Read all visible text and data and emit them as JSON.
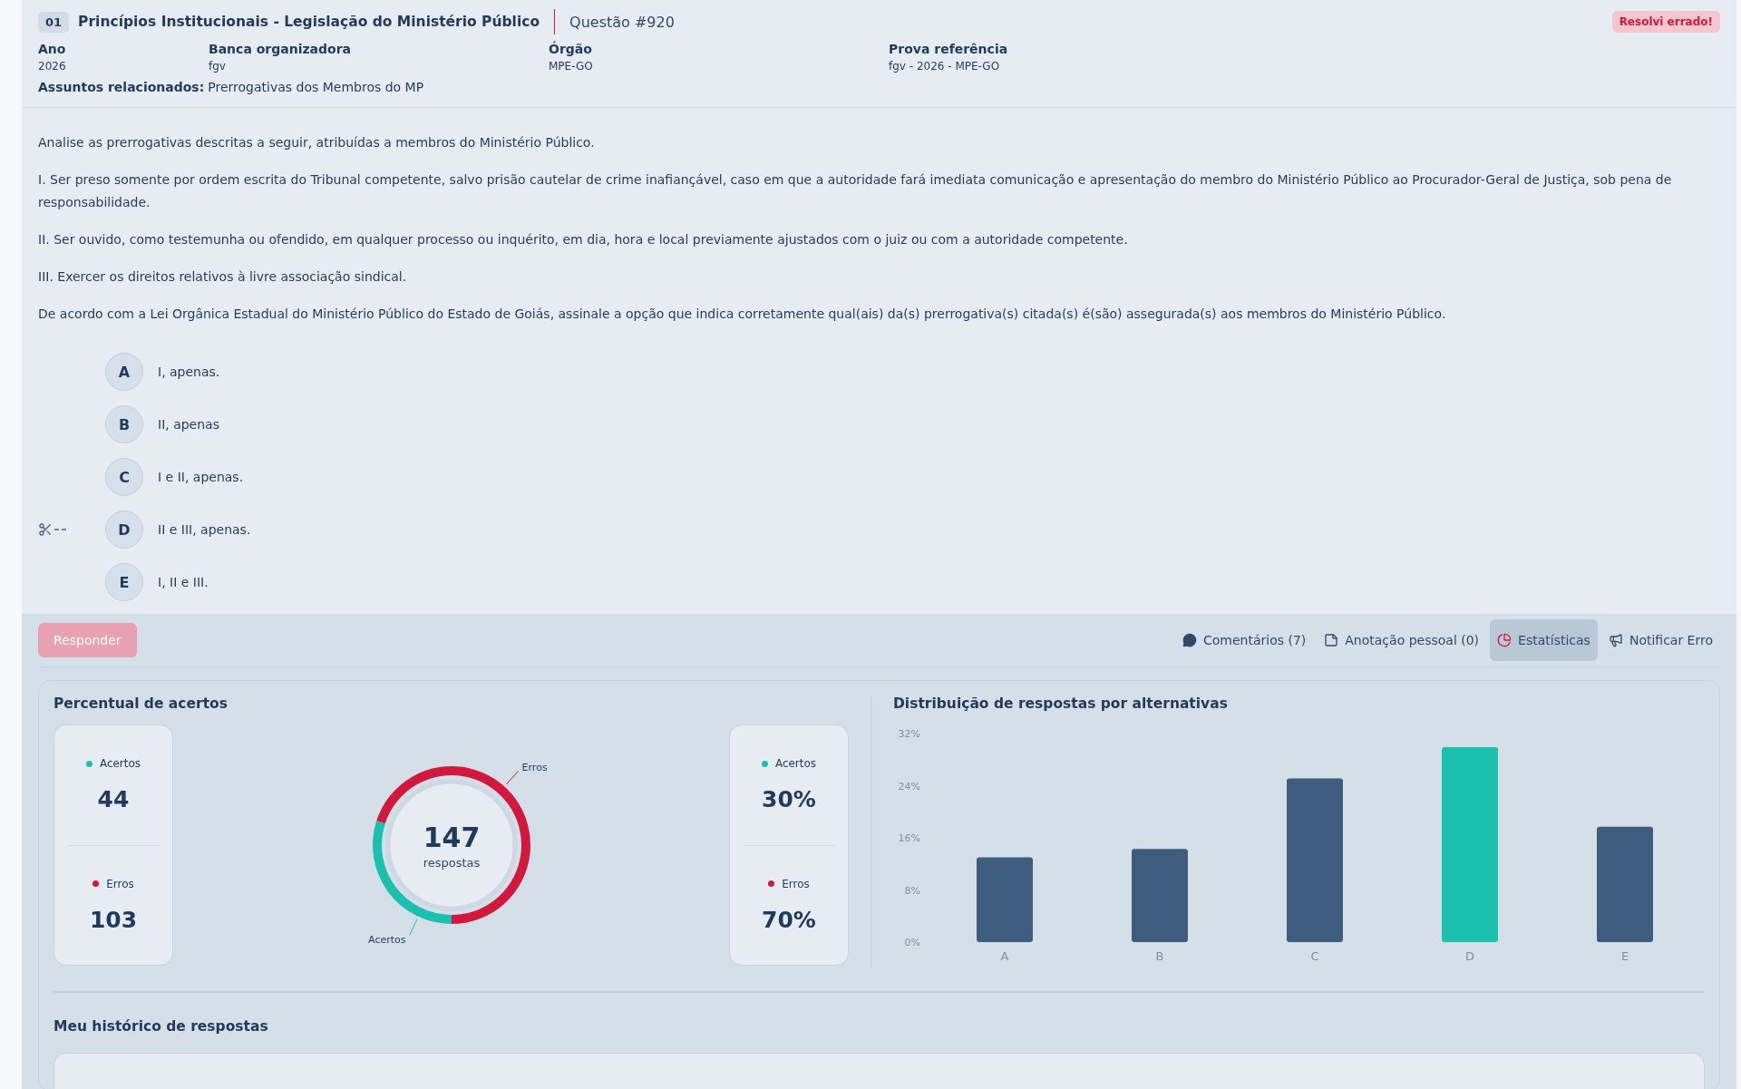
{
  "header": {
    "number": "01",
    "title": "Princípios Institucionais - Legislação do Ministério Público",
    "question": "Questão #920",
    "status_badge": "Resolvi errado!"
  },
  "meta": [
    {
      "label": "Ano",
      "value": "2026"
    },
    {
      "label": "Banca organizadora",
      "value": "fgv"
    },
    {
      "label": "Órgão",
      "value": "MPE-GO"
    },
    {
      "label": "Prova referência",
      "value": "fgv - 2026 - MPE-GO"
    }
  ],
  "subjects": {
    "label": "Assuntos relacionados:",
    "value": "Prerrogativas dos Membros do MP"
  },
  "statement": [
    "Analise as prerrogativas descritas a seguir, atribuídas a membros do Ministério Público.",
    "I. Ser preso somente por ordem escrita do Tribunal competente, salvo prisão cautelar de crime inafiançável, caso em que a autoridade fará imediata comunicação e apresentação do membro do Ministério Público ao Procurador-Geral de Justiça, sob pena de responsabilidade.",
    "II. Ser ouvido, como testemunha ou ofendido, em qualquer processo ou inquérito, em dia, hora e local previamente ajustados com o juiz ou com a autoridade competente.",
    "III. Exercer os direitos relativos à livre associação sindical.",
    "De acordo com a Lei Orgânica Estadual do Ministério Público do Estado de Goiás, assinale a opção que indica corretamente qual(ais) da(s) prerrogativa(s) citada(s) é(são) assegurada(s) aos membros do Ministério Público."
  ],
  "options": [
    {
      "letter": "A",
      "text": "I, apenas.",
      "scissors": false
    },
    {
      "letter": "B",
      "text": "II, apenas",
      "scissors": false
    },
    {
      "letter": "C",
      "text": "I e II, apenas.",
      "scissors": false
    },
    {
      "letter": "D",
      "text": "II e III, apenas.",
      "scissors": true
    },
    {
      "letter": "E",
      "text": "I, II e III.",
      "scissors": false
    }
  ],
  "answer_button": {
    "label": "Responder",
    "disabled": true
  },
  "tabs": [
    {
      "kind": "comments",
      "label": "Comentários (7)",
      "selected": false
    },
    {
      "kind": "notes",
      "label": "Anotação pessoal (0)",
      "selected": false
    },
    {
      "kind": "stats",
      "label": "Estatísticas",
      "selected": true
    },
    {
      "kind": "report",
      "label": "Notificar Erro",
      "selected": false
    }
  ],
  "stats": {
    "title": "Percentual de acertos",
    "counts": [
      {
        "label": "Acertos",
        "value": "44",
        "color": "#1cc0ae"
      },
      {
        "label": "Erros",
        "value": "103",
        "color": "#d3183e"
      }
    ],
    "percents": [
      {
        "label": "Acertos",
        "value": "30%",
        "color": "#1cc0ae"
      },
      {
        "label": "Erros",
        "value": "70%",
        "color": "#d3183e"
      }
    ],
    "donut": {
      "total": "147",
      "chart_data": {
        "type": "donut",
        "categories": [
          "Acertos",
          "Erros"
        ],
        "series": [
          {
            "name": "respostas",
            "values": [
              30,
              70
            ]
          }
        ]
      }
    }
  },
  "distribution": {
    "title": "Distribuição de respostas por alternativas",
    "chart_data": {
      "type": "bar",
      "categories": [
        "A",
        "B",
        "C",
        "D",
        "E"
      ],
      "stacked": true,
      "series": [
        {
          "color": "#3e5c7e",
          "values": [
            13,
            14.3,
            25.1,
            null,
            17.7
          ]
        },
        {
          "color": "#1cc0ae",
          "values": [
            null,
            null,
            null,
            29.9,
            null
          ]
        }
      ],
      "ylim": [
        0,
        32
      ],
      "yticks": [
        {
          "value": 0,
          "label": "0%"
        },
        {
          "value": 8,
          "label": "8%"
        },
        {
          "value": 16,
          "label": "16%"
        },
        {
          "value": 24,
          "label": "24%"
        },
        {
          "value": 32,
          "label": "32%"
        }
      ]
    }
  },
  "history": {
    "title": "Meu histórico de respostas"
  }
}
